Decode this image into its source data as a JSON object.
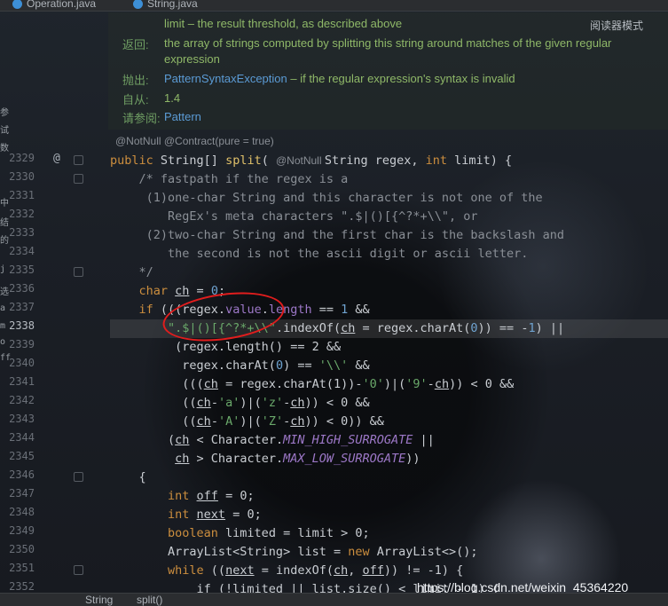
{
  "tabs": [
    {
      "label": "Operation.java"
    },
    {
      "label": "String.java"
    }
  ],
  "doc": {
    "reader_mode": "阅读器模式",
    "limit_line": "limit – the result threshold, as described above",
    "returns_key": "返回:",
    "returns_val_1": "the array of strings computed by splitting this string around matches of the given regular",
    "returns_val_2": "expression",
    "throws_key": "抛出:",
    "throws_link": "PatternSyntaxException",
    "throws_val": " – if the regular expression's syntax is invalid",
    "since_key": "自从:",
    "since_val": "1.4",
    "see_key": "请参阅:",
    "see_link": "Pattern"
  },
  "annotations": "@NotNull   @Contract(pure = true)",
  "gutter": {
    "at_icon": "@",
    "lines": [
      "2329",
      "2330",
      "2331",
      "2332",
      "2333",
      "2334",
      "2335",
      "2336",
      "2337",
      "2338",
      "2339",
      "2340",
      "2341",
      "2342",
      "2343",
      "2344",
      "2345",
      "2346",
      "2347",
      "2348",
      "2349",
      "2350",
      "2351",
      "2352"
    ]
  },
  "code": {
    "l2329a": "public ",
    "l2329b": "String[] ",
    "l2329c": "split",
    "l2329d": "( ",
    "l2329e": "@NotNull ",
    "l2329f": "String regex, ",
    "l2329g": "int ",
    "l2329h": "limit) {",
    "l2330": "    /* fastpath if the regex is a",
    "l2331": "     (1)one-char String and this character is not one of the",
    "l2332": "        RegEx's meta characters \".$|()[{^?*+\\\\\", or",
    "l2333": "     (2)two-char String and the first char is the backslash and",
    "l2334": "        the second is not the ascii digit or ascii letter.",
    "l2335": "    */",
    "l2336a": "    char ",
    "l2336b": "ch",
    "l2336c": " = ",
    "l2336d": "0",
    "l2336e": ";",
    "l2337a": "    if ",
    "l2337b": "(((regex.",
    "l2337c": "value",
    "l2337d": ".",
    "l2337e": "length",
    "l2337f": " == ",
    "l2337g": "1",
    "l2337h": " &&",
    "l2338a": "        \".$|()[{^?*+\\\\\"",
    "l2338b": ".indexOf(",
    "l2338c": "ch",
    "l2338d": " = regex.charAt(",
    "l2338e": "0",
    "l2338f": ")) == -",
    "l2338g": "1",
    "l2338h": ") ||",
    "l2339": "         (regex.length() == 2 &&",
    "l2340a": "          regex.charAt(",
    "l2340b": "0",
    "l2340c": ") == ",
    "l2340d": "'\\\\'",
    "l2340e": " &&",
    "l2341a": "          (((",
    "l2341b": "ch",
    "l2341c": " = regex.charAt(1))-",
    "l2341d": "'0'",
    "l2341e": ")|(",
    "l2341f": "'9'",
    "l2341g": "-",
    "l2341h": "ch",
    "l2341i": ")) < 0 &&",
    "l2342a": "          ((",
    "l2342b": "ch",
    "l2342c": "-",
    "l2342d": "'a'",
    "l2342e": ")|(",
    "l2342f": "'z'",
    "l2342g": "-",
    "l2342h": "ch",
    "l2342i": ")) < 0 &&",
    "l2343a": "          ((",
    "l2343b": "ch",
    "l2343c": "-",
    "l2343d": "'A'",
    "l2343e": ")|(",
    "l2343f": "'Z'",
    "l2343g": "-",
    "l2343h": "ch",
    "l2343i": ")) < 0)) &&",
    "l2344a": "        (",
    "l2344b": "ch",
    "l2344c": " < Character.",
    "l2344d": "MIN_HIGH_SURROGATE",
    "l2344e": " ||",
    "l2345a": "         ",
    "l2345b": "ch",
    "l2345c": " > Character.",
    "l2345d": "MAX_LOW_SURROGATE",
    "l2345e": "))",
    "l2346": "    {",
    "l2347a": "        int ",
    "l2347b": "off",
    "l2347c": " = 0;",
    "l2348a": "        int ",
    "l2348b": "next",
    "l2348c": " = 0;",
    "l2349a": "        boolean ",
    "l2349b": "limited = limit > 0;",
    "l2350a": "        ArrayList<String> list = ",
    "l2350b": "new ",
    "l2350c": "ArrayList<>();",
    "l2351a": "        while ",
    "l2351b": "((",
    "l2351c": "next",
    "l2351d": " = indexOf(",
    "l2351e": "ch",
    "l2351f": ", ",
    "l2351g": "off",
    "l2351h": ")) != -1) {",
    "l2352": "            if (!limited || list.size() < limit - 1) {"
  },
  "left_strip": [
    "参",
    "试",
    "数",
    "中",
    "结",
    "的",
    "j",
    "选",
    "a",
    "m",
    "o",
    "ff"
  ],
  "status_bar": {
    "crumb1": "String",
    "crumb2": "split()"
  },
  "watermark": "https://blog.csdn.net/weixin_45364220",
  "colors": {
    "keyword": "#cc8e3e",
    "string": "#6aa86a",
    "field": "#9d78c8",
    "comment": "#8a8f96",
    "number": "#6fa3d0",
    "red_circle": "#e11d1d"
  }
}
